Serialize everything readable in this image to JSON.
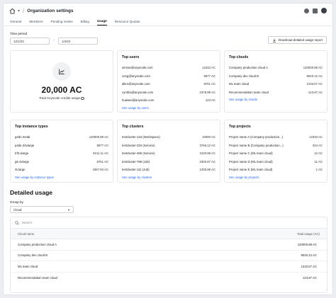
{
  "header": {
    "title": "Organization settings"
  },
  "tabs": [
    "General",
    "Members",
    "Pending invites",
    "Billing",
    "Usage",
    "Resource Quotas"
  ],
  "active_tab": "Usage",
  "time_period": {
    "label": "Time period",
    "start": "12/1/23",
    "end": "1/4/24",
    "separator": "-"
  },
  "download_button": "Download detailed usage report",
  "summary": {
    "value": "20,000 AC",
    "caption": "Total Anyscale credits usage"
  },
  "top_users": {
    "title": "Top users",
    "rows": [
      {
        "name": "simran@anyscale.com",
        "value": "12333 AC"
      },
      {
        "name": "cong@anyscale.com",
        "value": "9877 AC"
      },
      {
        "name": "allen@anyscale.com",
        "value": "8761 AC"
      },
      {
        "name": "cynthia@anyscale.com",
        "value": "2378.99 AC"
      },
      {
        "name": "huaiwei@anyscale.com",
        "value": "123 AC"
      }
    ],
    "link": "See usage by users"
  },
  "top_clouds": {
    "title": "Top clouds",
    "rows": [
      {
        "name": "Company production cloud A",
        "value": "120000.88 AC"
      },
      {
        "name": "Company dev cloud B",
        "value": "9020.12 AC"
      },
      {
        "name": "ML team cloud",
        "value": "1233.67 AC"
      },
      {
        "name": "Recommendation team cloud",
        "value": "143.87 AC"
      }
    ],
    "link": "See usage by clouds"
  },
  "top_instance_types": {
    "title": "Top instance types",
    "rows": [
      {
        "name": "g4dn.metal",
        "value": "120000.88 AC"
      },
      {
        "name": "p4de.24xlarge",
        "value": "9877 AC"
      },
      {
        "name": "trf2.xlarge",
        "value": "9211.11 AC"
      },
      {
        "name": "g6.4xlarge",
        "value": "8761 AC"
      },
      {
        "name": "r5.large",
        "value": "4367.84 AC"
      }
    ],
    "link": "See usage by instance types"
  },
  "top_clusters": {
    "title": "Top clusters",
    "rows": [
      {
        "name": "testcluster-123 (Workspace)",
        "value": "10000 AC"
      },
      {
        "name": "testcluster-234 (Service)",
        "value": "3765.12 AC"
      },
      {
        "name": "testcluster-456 (Service)",
        "value": "3100.99 AC"
      },
      {
        "name": "testcluster-789 (Job)",
        "value": "2300.87 AC"
      },
      {
        "name": "testcluster-111 (Job)",
        "value": "1305.88 AC"
      }
    ],
    "link": "See usage by clusters"
  },
  "top_projects": {
    "title": "Top projects",
    "rows": [
      {
        "name": "Project name A (Company production...)",
        "value": "12333 AC"
      },
      {
        "name": "Project name B (Company production...)",
        "value": "324 AC"
      },
      {
        "name": "Project name C (ML team cloud)",
        "value": "12 AC"
      },
      {
        "name": "Project name D (ML team cloud)",
        "value": "11 AC"
      },
      {
        "name": "Project name E (ML team cloud)",
        "value": "1 AC"
      }
    ],
    "link": "See usage by projects"
  },
  "detailed": {
    "title": "Detailed usage",
    "group_label": "Group by",
    "group_value": "Cloud",
    "search_placeholder": "Search",
    "columns": [
      "Cloud name",
      "Total usage (AC)"
    ],
    "rows": [
      {
        "name": "Company production cloud A",
        "value": "120000.88 AC"
      },
      {
        "name": "Company dev cloud B",
        "value": "9020.12 AC"
      },
      {
        "name": "ML team cloud",
        "value": "1233.67 AC"
      },
      {
        "name": "Recommendation team cloud",
        "value": "143.87 AC"
      }
    ]
  },
  "icons": [
    "home-icon",
    "chevron-down-icon",
    "help-icon",
    "docs-icon",
    "avatar",
    "download-icon",
    "chart-icon",
    "info-icon",
    "search-icon"
  ],
  "colors": {
    "link": "#2563eb",
    "text": "#1f2328"
  }
}
